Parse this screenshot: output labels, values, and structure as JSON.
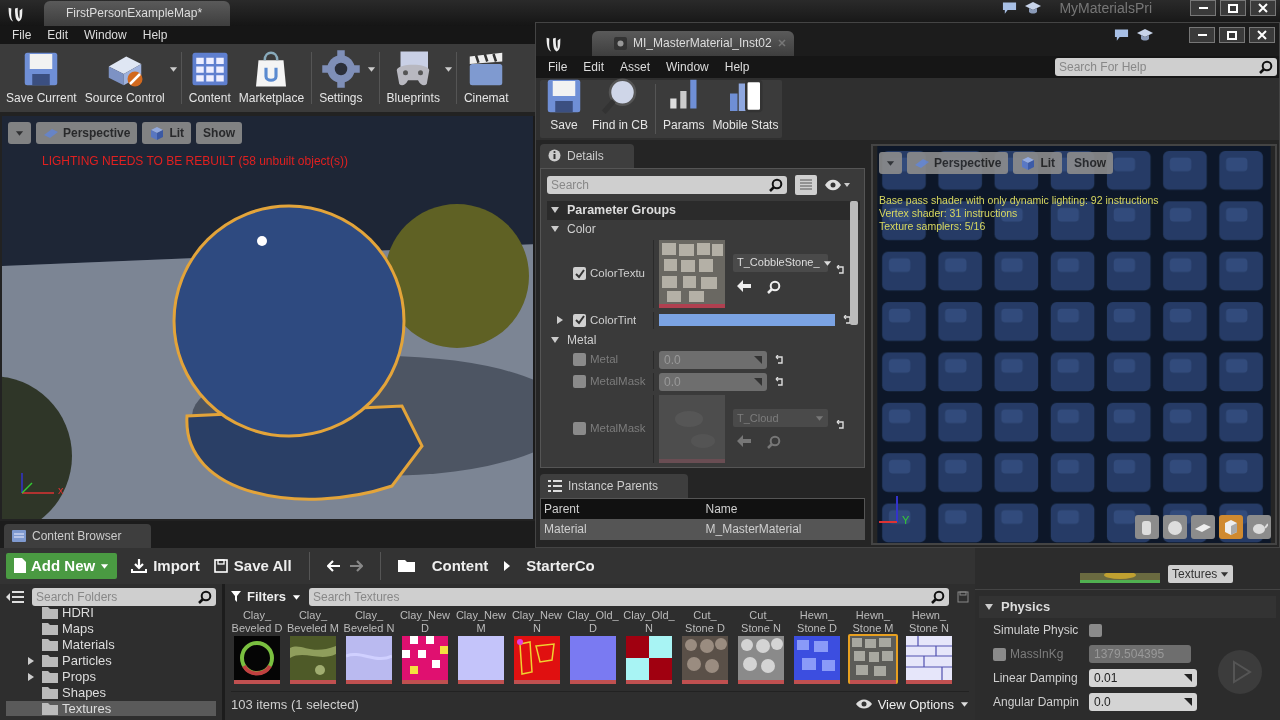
{
  "main_window": {
    "tab": "FirstPersonExampleMap*",
    "project": "MyMaterialsPri",
    "menu": [
      "File",
      "Edit",
      "Window",
      "Help"
    ],
    "toolbar": [
      {
        "label": "Save Current",
        "dropdown": false
      },
      {
        "label": "Source Control",
        "dropdown": true
      },
      {
        "label": "Content",
        "dropdown": false
      },
      {
        "label": "Marketplace",
        "dropdown": false
      },
      {
        "label": "Settings",
        "dropdown": true
      },
      {
        "label": "Blueprints",
        "dropdown": true
      },
      {
        "label": "Cinemat",
        "dropdown": false
      }
    ],
    "viewport": {
      "buttons": [
        "Perspective",
        "Lit",
        "Show"
      ],
      "warning": "LIGHTING NEEDS TO BE REBUILT (58 unbuilt object(s))",
      "axis_label": "x"
    },
    "content_browser": {
      "tab": "Content Browser",
      "add_new": "Add New",
      "import": "Import",
      "save_all": "Save All",
      "path": [
        "Content",
        "StarterCo"
      ],
      "folder_search": {
        "placeholder": "Search Folders"
      },
      "folders": [
        {
          "name": "HDRI",
          "has_children": false,
          "selected": false
        },
        {
          "name": "Maps",
          "has_children": false,
          "selected": false
        },
        {
          "name": "Materials",
          "has_children": false,
          "selected": false
        },
        {
          "name": "Particles",
          "has_children": true,
          "selected": false
        },
        {
          "name": "Props",
          "has_children": true,
          "selected": false
        },
        {
          "name": "Shapes",
          "has_children": false,
          "selected": false
        },
        {
          "name": "Textures",
          "has_children": false,
          "selected": true
        }
      ],
      "filters": "Filters",
      "asset_search": {
        "placeholder": "Search Textures"
      },
      "assets": [
        {
          "label": [
            "Clay_",
            "Beveled D"
          ],
          "selected": false
        },
        {
          "label": [
            "Clay_",
            "Beveled M"
          ],
          "selected": false
        },
        {
          "label": [
            "Clay_",
            "Beveled N"
          ],
          "selected": false
        },
        {
          "label": [
            "Clay_New",
            "D"
          ],
          "selected": false
        },
        {
          "label": [
            "Clay_New",
            "M"
          ],
          "selected": false
        },
        {
          "label": [
            "Clay_New",
            "N"
          ],
          "selected": false
        },
        {
          "label": [
            "Clay_Old_",
            "D"
          ],
          "selected": false
        },
        {
          "label": [
            "Clay_Old_",
            "N"
          ],
          "selected": false
        },
        {
          "label": [
            "Cut_",
            "Stone D"
          ],
          "selected": false
        },
        {
          "label": [
            "Cut_",
            "Stone N"
          ],
          "selected": false
        },
        {
          "label": [
            "Hewn_",
            "Stone D"
          ],
          "selected": false
        },
        {
          "label": [
            "Hewn_",
            "Stone M"
          ],
          "selected": true
        },
        {
          "label": [
            "Hewn_",
            "Stone N"
          ],
          "selected": false
        }
      ],
      "status": "103 items (1 selected)",
      "view_options": "View Options"
    },
    "details": {
      "texture_dropdown": "Textures",
      "physics": {
        "title": "Physics",
        "expanded": true,
        "rows": [
          {
            "kind": "checkbox",
            "label": "Simulate Physic",
            "checked": false
          },
          {
            "kind": "locked",
            "label": "MassInKg",
            "checked": false,
            "value": "1379.504395"
          },
          {
            "kind": "spin",
            "label": "Linear Damping",
            "value": "0.01"
          },
          {
            "kind": "spin",
            "label": "Angular Dampin",
            "value": "0.0"
          }
        ]
      }
    }
  },
  "material_editor": {
    "tab": "MI_MasterMaterial_Inst02",
    "menu": [
      "File",
      "Edit",
      "Asset",
      "Window",
      "Help"
    ],
    "help_search": {
      "placeholder": "Search For Help"
    },
    "toolbar": [
      "Save",
      "Find in CB",
      "Params",
      "Mobile Stats"
    ],
    "details": {
      "tab": "Details",
      "search": {
        "placeholder": "Search"
      },
      "root": {
        "label": "Parameter Groups",
        "expanded": true,
        "groups": [
          {
            "name": "Color",
            "expanded": true,
            "params": [
              {
                "kind": "texture",
                "label": "ColorTextu",
                "checked": true,
                "value": "T_CobbleStone_"
              },
              {
                "kind": "color",
                "label": "ColorTint",
                "checked": true,
                "expanded": false,
                "color": "#7ba3e3"
              }
            ]
          },
          {
            "name": "Metal",
            "expanded": true,
            "params": [
              {
                "kind": "number",
                "label": "Metal",
                "checked": false,
                "value": "0.0"
              },
              {
                "kind": "number",
                "label": "MetalMask",
                "checked": false,
                "value": "0.0"
              },
              {
                "kind": "texture",
                "label": "MetalMask",
                "checked": false,
                "value": "T_Cloud"
              }
            ]
          }
        ]
      }
    },
    "instance_parents": {
      "tab": "Instance Parents",
      "columns": [
        "Parent",
        "Name"
      ],
      "rows": [
        [
          "Material",
          "M_MasterMaterial"
        ]
      ]
    },
    "preview": {
      "buttons": [
        "Perspective",
        "Lit",
        "Show"
      ],
      "stats": [
        "Base pass shader with only dynamic lighting: 92 instructions",
        "Vertex shader: 31 instructions",
        "Texture samplers: 5/16"
      ],
      "axis_label": "Y",
      "shape_buttons": [
        {
          "selected": false
        },
        {
          "selected": false
        },
        {
          "selected": false
        },
        {
          "selected": true
        },
        {
          "selected": false
        }
      ]
    }
  }
}
